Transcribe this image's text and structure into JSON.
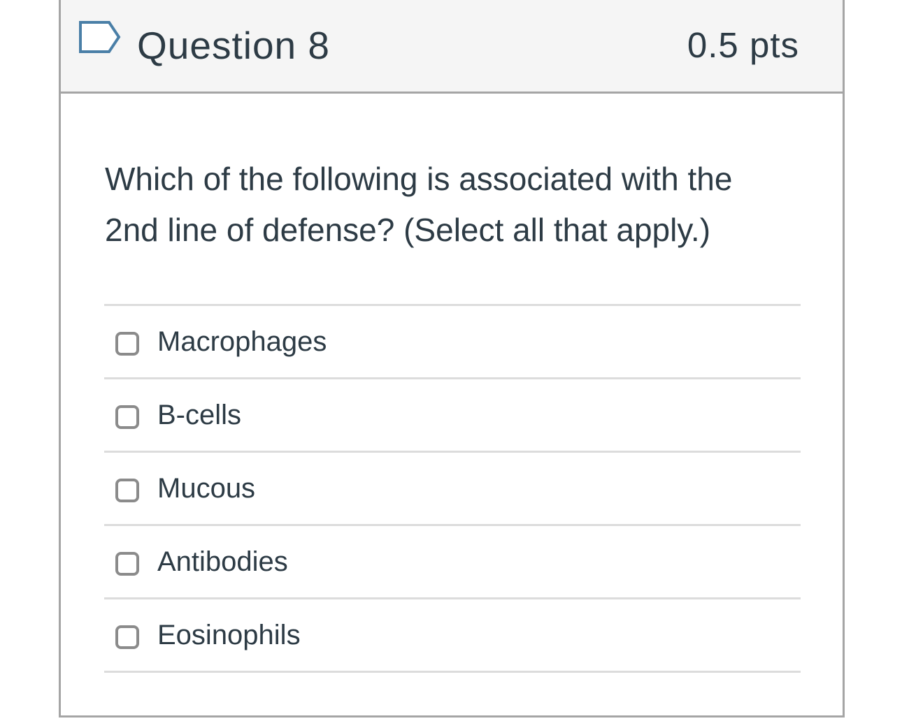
{
  "header": {
    "title": "Question 8",
    "points": "0.5 pts",
    "flag_icon": "flag-outline-icon"
  },
  "question": {
    "text_line1": "Which of the following is associated with the",
    "text_line2": "2nd line of defense? (Select all that apply.)"
  },
  "answers": [
    {
      "label": "Macrophages",
      "checked": false
    },
    {
      "label": "B-cells",
      "checked": false
    },
    {
      "label": "Mucous",
      "checked": false
    },
    {
      "label": "Antibodies",
      "checked": false
    },
    {
      "label": "Eosinophils",
      "checked": false
    }
  ],
  "colors": {
    "text": "#2d3b45",
    "header_bg": "#f5f5f5",
    "border": "#a5a5a5",
    "divider": "#dcdcdc",
    "flag": "#4a7fa7"
  }
}
